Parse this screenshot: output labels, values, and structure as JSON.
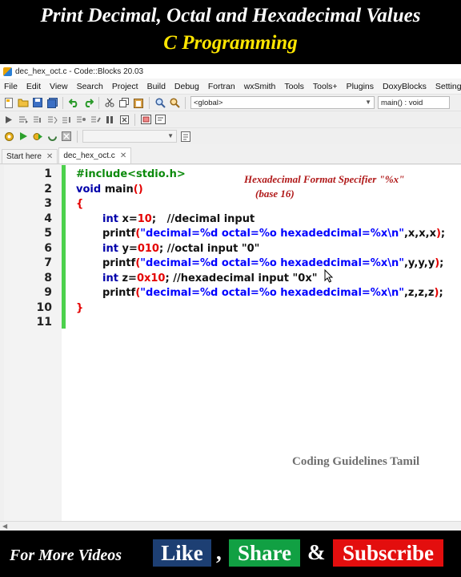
{
  "banner": {
    "title_line1": "Print Decimal, Octal and Hexadecimal Values",
    "title_line2": "C Programming"
  },
  "window": {
    "title": "dec_hex_oct.c - Code::Blocks 20.03"
  },
  "menu": [
    "File",
    "Edit",
    "View",
    "Search",
    "Project",
    "Build",
    "Debug",
    "Fortran",
    "wxSmith",
    "Tools",
    "Tools+",
    "Plugins",
    "DoxyBlocks",
    "Settings"
  ],
  "toolbar": {
    "scope_combo": "<global>",
    "function_combo": "main() : void"
  },
  "tabs": [
    {
      "label": "Start here",
      "close": "✕"
    },
    {
      "label": "dec_hex_oct.c",
      "close": "✕"
    }
  ],
  "editor": {
    "line_numbers": [
      "1",
      "2",
      "3",
      "4",
      "5",
      "6",
      "7",
      "8",
      "9",
      "10",
      "11"
    ],
    "lines": [
      "#include<stdio.h>",
      "void main()",
      "{",
      "int x=10;   //decimal input",
      "printf(\"decimal=%d octal=%o hexadedcimal=%x\\n\",x,x,x);",
      "int y=010; //octal input \"0\"",
      "printf(\"decimal=%d octal=%o hexadedcimal=%x\\n\",y,y,y);",
      "int z=0x10; //hexadecimal input \"0x\"",
      "printf(\"decimal=%d octal=%o hexadedcimal=%x\\n\",z,z,z);",
      "}",
      ""
    ]
  },
  "annotation": {
    "line1": "Hexadecimal Format Specifier \"%x\"",
    "line2": "(base 16)"
  },
  "watermark": "Coding Guidelines Tamil",
  "footer": {
    "more_videos": "For More Videos",
    "like": "Like",
    "comma": ",",
    "share": "Share",
    "amp": "&",
    "subscribe": "Subscribe"
  },
  "colors": {
    "keyword": "#0000aa",
    "preprocessor": "#0b8a0b",
    "number": "#e40000",
    "string": "#0000ff",
    "annotation": "#b01818",
    "banner_title2": "#ffe600",
    "like_bg": "#1d3f73",
    "share_bg": "#11a043",
    "subscribe_bg": "#e30e0e"
  }
}
